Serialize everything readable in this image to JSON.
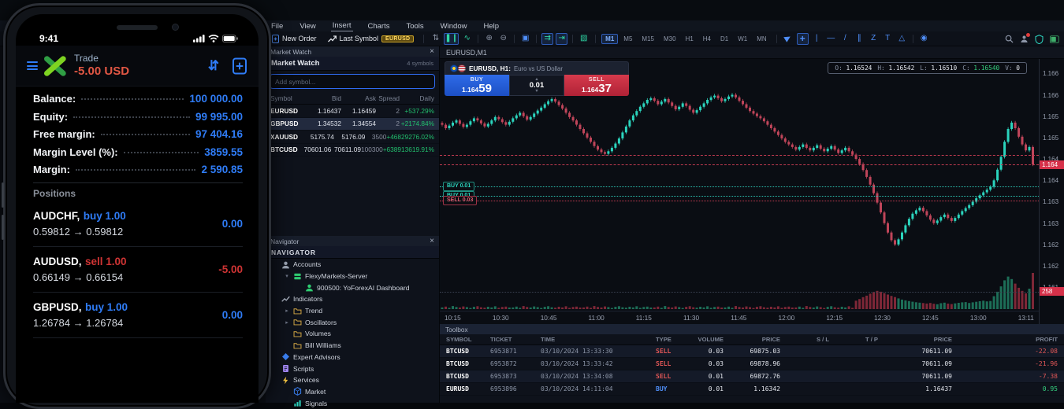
{
  "phone": {
    "status_time": "9:41",
    "header": {
      "title": "Trade",
      "pl": "-5.00 USD",
      "transfer_glyph": "⇵"
    },
    "account_rows": [
      {
        "label": "Balance:",
        "value": "100 000.00"
      },
      {
        "label": "Equity:",
        "value": "99 995.00"
      },
      {
        "label": "Free margin:",
        "value": "97 404.16"
      },
      {
        "label": "Margin Level (%):",
        "value": "3859.55"
      },
      {
        "label": "Margin:",
        "value": "2 590.85"
      }
    ],
    "positions_title": "Positions",
    "positions": [
      {
        "symbol": "AUDCHF,",
        "side_label": "buy 1.00",
        "side_cls": "buy",
        "prices": "0.59812 → 0.59812",
        "profit": "0.00",
        "profit_cls": "blue"
      },
      {
        "symbol": "AUDUSD,",
        "side_label": "sell 1.00",
        "side_cls": "sell",
        "prices": "0.66149 → 0.66154",
        "profit": "-5.00",
        "profit_cls": "red"
      },
      {
        "symbol": "GBPUSD,",
        "side_label": "buy 1.00",
        "side_cls": "buy",
        "prices": "1.26784 → 1.26784",
        "profit": "0.00",
        "profit_cls": "blue"
      }
    ]
  },
  "desktop": {
    "menu": {
      "items": [
        {
          "label": "File",
          "cls": ""
        },
        {
          "label": "View",
          "cls": ""
        },
        {
          "label": "Insert",
          "cls": "active"
        },
        {
          "label": "Charts",
          "cls": ""
        },
        {
          "label": "Tools",
          "cls": ""
        },
        {
          "label": "Window",
          "cls": ""
        },
        {
          "label": "Help",
          "cls": ""
        }
      ]
    },
    "toolbar": {
      "new_order_label": "New Order",
      "last_symbol_label": "Last Symbol",
      "symbol_badge": "EURUSD",
      "buttons": [
        {
          "name": "tick-chart-button",
          "glyph": "⇅",
          "cls": ""
        },
        {
          "name": "candlestick-chart-button",
          "glyph": "❚❙",
          "cls": "active green"
        },
        {
          "name": "line-chart-button",
          "glyph": "∿",
          "cls": "green"
        },
        {
          "name": "separator",
          "glyph": "",
          "cls": "sep"
        },
        {
          "name": "zoom-in-button",
          "glyph": "⊕",
          "cls": ""
        },
        {
          "name": "zoom-out-button",
          "glyph": "⊖",
          "cls": ""
        },
        {
          "name": "separator",
          "glyph": "",
          "cls": "sep"
        },
        {
          "name": "tile-windows-button",
          "glyph": "▣",
          "cls": "blue"
        },
        {
          "name": "separator",
          "glyph": "",
          "cls": "sep"
        },
        {
          "name": "auto-scroll-button",
          "glyph": "⇉",
          "cls": "active green"
        },
        {
          "name": "chart-shift-button",
          "glyph": "⇥",
          "cls": "active green"
        },
        {
          "name": "separator",
          "glyph": "",
          "cls": "sep"
        },
        {
          "name": "new-chart-button",
          "glyph": "▧",
          "cls": "green"
        }
      ],
      "timeframes": [
        {
          "label": "M1",
          "cls": "active"
        },
        {
          "label": "M5",
          "cls": ""
        },
        {
          "label": "M15",
          "cls": ""
        },
        {
          "label": "M30",
          "cls": ""
        },
        {
          "label": "H1",
          "cls": ""
        },
        {
          "label": "H4",
          "cls": ""
        },
        {
          "label": "D1",
          "cls": ""
        },
        {
          "label": "W1",
          "cls": ""
        },
        {
          "label": "MN",
          "cls": ""
        }
      ],
      "draw_tools": [
        {
          "name": "cursor-tool-button",
          "glyph": "▶",
          "cls": "blue cursor"
        },
        {
          "name": "crosshair-tool-button",
          "glyph": "+",
          "cls": "active blue big"
        },
        {
          "name": "vertical-line-tool-button",
          "glyph": "|",
          "cls": "blue"
        },
        {
          "name": "horizontal-line-tool-button",
          "glyph": "—",
          "cls": "blue"
        },
        {
          "name": "trendline-tool-button",
          "glyph": "/",
          "cls": "blue"
        },
        {
          "name": "channel-tool-button",
          "glyph": "∥",
          "cls": "blue"
        },
        {
          "name": "equidistant-channel-tool-button",
          "glyph": "Z",
          "cls": "blue"
        },
        {
          "name": "text-tool-button",
          "glyph": "T",
          "cls": "blue"
        },
        {
          "name": "shapes-tool-button",
          "glyph": "△",
          "cls": "blue"
        },
        {
          "name": "separator",
          "glyph": "",
          "cls": "sep"
        },
        {
          "name": "camera-button",
          "glyph": "◉",
          "cls": "blue"
        }
      ]
    },
    "market_watch": {
      "window_title": "Market Watch",
      "close_glyph": "×",
      "header_title": "Market Watch",
      "symbols_count": "4 symbols",
      "search_placeholder": "Add symbol...",
      "columns": {
        "symbol": "Symbol",
        "bid": "Bid",
        "ask": "Ask",
        "spread": "Spread",
        "daily": "Daily"
      },
      "rows": [
        {
          "symbol": "EURUSD",
          "bid": "1.16437",
          "ask": "1.16459",
          "spread": "2",
          "daily": "+537.29%",
          "row_cls": ""
        },
        {
          "symbol": "GBPUSD",
          "bid": "1.34532",
          "ask": "1.34554",
          "spread": "2",
          "daily": "+2174.84%",
          "row_cls": "selected"
        },
        {
          "symbol": "XAUUSD",
          "bid": "5175.74",
          "ask": "5176.09",
          "spread": "3500",
          "daily": "+46829276.02%",
          "row_cls": ""
        },
        {
          "symbol": "BTCUSD",
          "bid": "70601.06",
          "ask": "70611.09",
          "spread": "100300",
          "daily": "+638913619.91%",
          "row_cls": ""
        }
      ]
    },
    "navigator": {
      "window_title": "Navigator",
      "close_glyph": "×",
      "header_title": "NAVIGATOR",
      "items": [
        {
          "depth": 0,
          "chev": "",
          "icon": "person",
          "label": "Accounts"
        },
        {
          "depth": 1,
          "chev": "▾",
          "icon": "server",
          "label": "FlexyMarkets-Server"
        },
        {
          "depth": 2,
          "chev": "",
          "icon": "user-green",
          "label": "900500: YoForexAI Dashboard"
        },
        {
          "depth": 0,
          "chev": "",
          "icon": "indicator",
          "label": "Indicators"
        },
        {
          "depth": 1,
          "chev": "▸",
          "icon": "folder",
          "label": "Trend"
        },
        {
          "depth": 1,
          "chev": "▸",
          "icon": "folder",
          "label": "Oscillators"
        },
        {
          "depth": 1,
          "chev": "",
          "icon": "folder",
          "label": "Volumes"
        },
        {
          "depth": 1,
          "chev": "",
          "icon": "folder",
          "label": "Bill Williams"
        },
        {
          "depth": 0,
          "chev": "",
          "icon": "ea",
          "label": "Expert Advisors"
        },
        {
          "depth": 0,
          "chev": "",
          "icon": "script",
          "label": "Scripts"
        },
        {
          "depth": 0,
          "chev": "",
          "icon": "services",
          "label": "Services"
        },
        {
          "depth": 1,
          "chev": "",
          "icon": "market",
          "label": "Market"
        },
        {
          "depth": 1,
          "chev": "",
          "icon": "signals",
          "label": "Signals"
        }
      ]
    },
    "chart": {
      "tab": "EURUSD,M1",
      "info": {
        "o_label": "O:",
        "o": "1.16524",
        "h_label": "H:",
        "h": "1.16542",
        "l_label": "L:",
        "l": "1.16510",
        "c_label": "C:",
        "c": "1.16540",
        "v_label": "V:",
        "v": "0"
      },
      "widget": {
        "pair_bold": "EURUSD, H1:",
        "pair_desc": "Euro vs US Dollar",
        "buy_label": "BUY",
        "buy_small": "1.164",
        "buy_big": "59",
        "volume": "0.01",
        "up_glyph": "▲",
        "down_glyph": "▼",
        "sell_label": "SELL",
        "sell_small": "1.164",
        "sell_big": "37"
      },
      "axis": {
        "labels": [
          "1.166",
          "1.166",
          "1.165",
          "1.165",
          "1.164",
          "1.164",
          "1.163",
          "1.163",
          "1.162",
          "1.162",
          "1.161"
        ],
        "label_pips": [
          650,
          600,
          550,
          500,
          450,
          400,
          350,
          300,
          250,
          200,
          150
        ],
        "price_tag": "1.164",
        "price_tag_pip": 437,
        "volume_tag": "258"
      },
      "time_labels": [
        "10:15",
        "10:30",
        "10:45",
        "11:00",
        "11:15",
        "11:30",
        "11:45",
        "12:00",
        "12:15",
        "12:30",
        "12:45",
        "13:00",
        "13:11"
      ],
      "lines": {
        "ask_pip": 459,
        "bid_pip": 437
      },
      "position_tags": [
        {
          "label": "BUY 0.01",
          "side": "buy",
          "pip": 385
        },
        {
          "label": "BUY 0.01",
          "side": "buy",
          "pip": 364
        },
        {
          "label": "SELL 0.03",
          "side": "sell",
          "pip": 352
        }
      ],
      "chart_data": {
        "type": "candlestick",
        "symbol": "EURUSD",
        "timeframe": "M1",
        "base_price": 1.16,
        "pip_divisor": 100000,
        "ylim_pips": [
          110,
          680
        ],
        "volume_max": 258,
        "closes_pips": [
          530,
          522,
          528,
          535,
          540,
          532,
          525,
          530,
          538,
          545,
          540,
          533,
          526,
          532,
          540,
          548,
          543,
          536,
          530,
          537,
          545,
          552,
          558,
          550,
          542,
          548,
          556,
          563,
          570,
          578,
          585,
          590,
          584,
          576,
          568,
          558,
          548,
          540,
          530,
          520,
          510,
          500,
          490,
          480,
          472,
          466,
          462,
          468,
          476,
          486,
          498,
          512,
          526,
          540,
          552,
          562,
          572,
          580,
          588,
          592,
          586,
          578,
          584,
          590,
          582,
          574,
          566,
          572,
          580,
          574,
          565,
          558,
          564,
          572,
          580,
          588,
          594,
          598,
          592,
          585,
          590,
          596,
          600,
          594,
          586,
          578,
          570,
          562,
          556,
          550,
          545,
          538,
          530,
          522,
          514,
          506,
          498,
          490,
          484,
          478,
          472,
          478,
          484,
          476,
          470,
          476,
          482,
          474,
          468,
          474,
          480,
          472,
          464,
          470,
          476,
          468,
          460,
          450,
          438,
          424,
          408,
          390,
          370,
          348,
          325,
          300,
          278,
          260,
          250,
          262,
          278,
          295,
          310,
          322,
          330,
          336,
          328,
          318,
          308,
          300,
          306,
          314,
          320,
          312,
          305,
          312,
          320,
          328,
          335,
          342,
          350,
          358,
          365,
          372,
          378,
          385,
          400,
          425,
          455,
          490,
          520,
          535,
          522,
          502,
          484,
          470,
          478,
          437
        ],
        "volumes": [
          12,
          18,
          9,
          22,
          15,
          11,
          19,
          14,
          8,
          16,
          21,
          13,
          10,
          17,
          12,
          20,
          9,
          15,
          18,
          11,
          12,
          18,
          9,
          22,
          15,
          11,
          19,
          14,
          8,
          16,
          21,
          13,
          10,
          17,
          12,
          20,
          9,
          15,
          18,
          11,
          12,
          18,
          9,
          22,
          15,
          11,
          19,
          14,
          8,
          16,
          21,
          13,
          10,
          17,
          12,
          20,
          9,
          15,
          18,
          11,
          12,
          18,
          9,
          22,
          15,
          11,
          19,
          14,
          8,
          16,
          21,
          13,
          10,
          17,
          12,
          20,
          9,
          15,
          18,
          11,
          12,
          18,
          9,
          22,
          15,
          11,
          19,
          14,
          8,
          16,
          21,
          13,
          10,
          17,
          12,
          20,
          9,
          15,
          18,
          11,
          12,
          18,
          9,
          22,
          15,
          11,
          19,
          14,
          8,
          16,
          21,
          13,
          10,
          17,
          12,
          20,
          9,
          60,
          72,
          85,
          96,
          110,
          122,
          130,
          124,
          114,
          104,
          94,
          86,
          76,
          68,
          62,
          57,
          53,
          49,
          46,
          43,
          40,
          44,
          38,
          35,
          42,
          46,
          39,
          36,
          41,
          45,
          48,
          50,
          44,
          48,
          52,
          56,
          60,
          55,
          58,
          92,
          124,
          162,
          205,
          232,
          214,
          182,
          152,
          130,
          112,
          146,
          258
        ],
        "colors": {
          "up": "#2bd4bd",
          "down": "#c0455a",
          "vol_up": "#1d6e57",
          "vol_down": "#7e2737"
        }
      }
    },
    "toolbox": {
      "title": "Toolbox",
      "columns": {
        "symbol": "SYMBOL",
        "ticket": "TICKET",
        "time": "TIME",
        "type": "TYPE",
        "volume": "VOLUME",
        "price": "PRICE",
        "sl": "S / L",
        "tp": "T / P",
        "price2": "PRICE",
        "profit": "PROFIT"
      },
      "rows": [
        {
          "symbol": "BTCUSD",
          "ticket": "6953871",
          "time": "03/10/2024 13:33:30",
          "type": "SELL",
          "type_cls": "sell",
          "volume": "0.03",
          "price": "69875.03",
          "sl": "",
          "tp": "",
          "price2": "70611.09",
          "profit": "-22.08",
          "profit_cls": "neg"
        },
        {
          "symbol": "BTCUSD",
          "ticket": "6953872",
          "time": "03/10/2024 13:33:42",
          "type": "SELL",
          "type_cls": "sell",
          "volume": "0.03",
          "price": "69878.96",
          "sl": "",
          "tp": "",
          "price2": "70611.09",
          "profit": "-21.96",
          "profit_cls": "neg"
        },
        {
          "symbol": "BTCUSD",
          "ticket": "6953873",
          "time": "03/10/2024 13:34:08",
          "type": "SELL",
          "type_cls": "sell",
          "volume": "0.01",
          "price": "69872.76",
          "sl": "",
          "tp": "",
          "price2": "70611.09",
          "profit": "-7.38",
          "profit_cls": "neg"
        },
        {
          "symbol": "EURUSD",
          "ticket": "6953896",
          "time": "03/10/2024 14:11:04",
          "type": "BUY",
          "type_cls": "buy",
          "volume": "0.01",
          "price": "1.16342",
          "sl": "",
          "tp": "",
          "price2": "1.16437",
          "profit": "0.95",
          "profit_cls": "pos"
        }
      ]
    }
  }
}
